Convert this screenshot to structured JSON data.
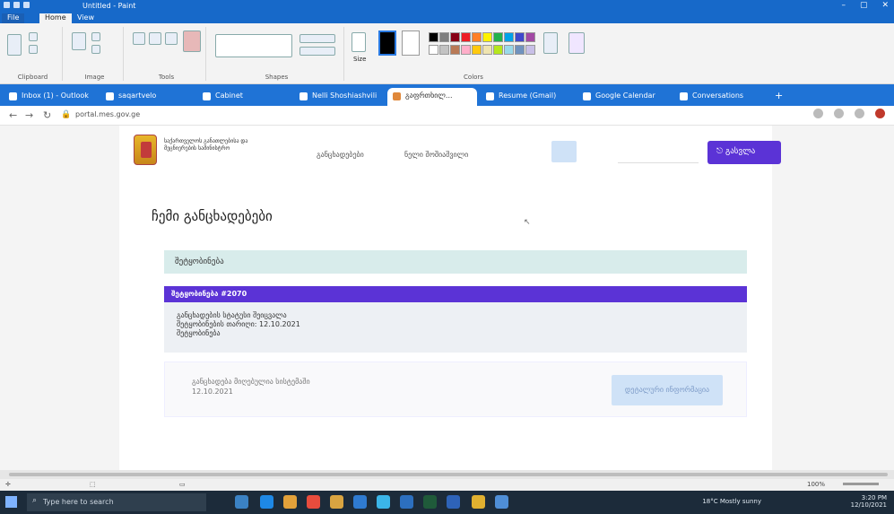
{
  "paint": {
    "title": "Untitled - Paint",
    "tabs": [
      "File",
      "Home",
      "View"
    ],
    "groups": [
      "Clipboard",
      "Image",
      "Tools",
      "Shapes",
      "Colors"
    ],
    "size_label": "Size",
    "status": {
      "zoom": "100%"
    }
  },
  "browser": {
    "tabs": [
      "Inbox (1) - Outlook",
      "saqartvelo",
      "Cabinet",
      "Nelli Shoshiashvili",
      "გაფრთხილ...",
      "Resume (Gmail)",
      "Google Calendar",
      "Conversations"
    ],
    "active_tab_index": 4,
    "url": "portal.mes.gov.ge"
  },
  "page": {
    "org_name": "საქართველოს განათლებისა და მეცნიერების სამინისტრო",
    "nav_link": "განცხადებები",
    "user_text": "ნელი შოშიაშვილი",
    "logout": "გასვლა",
    "title": "ჩემი განცხადებები",
    "section": "შეტყობინება",
    "notification": {
      "header": "შეტყობინება #2070",
      "line1": "განცხადების სტატუსი შეიცვალა",
      "line2": "შეტყობინების თარიღი: 12.10.2021",
      "line3": "შეტყობინება"
    },
    "lower": {
      "line1": "განცხადება მიღებულია სისტემაში",
      "line2": "12.10.2021",
      "button": "დეტალური ინფორმაცია"
    }
  },
  "taskbar": {
    "search_placeholder": "Type here to search",
    "time": "3:20 PM",
    "date": "12/10/2021",
    "weather": "18°C Mostly sunny"
  },
  "colors": {
    "accent": "#5b33d6",
    "section_bg": "#d8eceb",
    "browser_tabs": "#1f73d6"
  }
}
